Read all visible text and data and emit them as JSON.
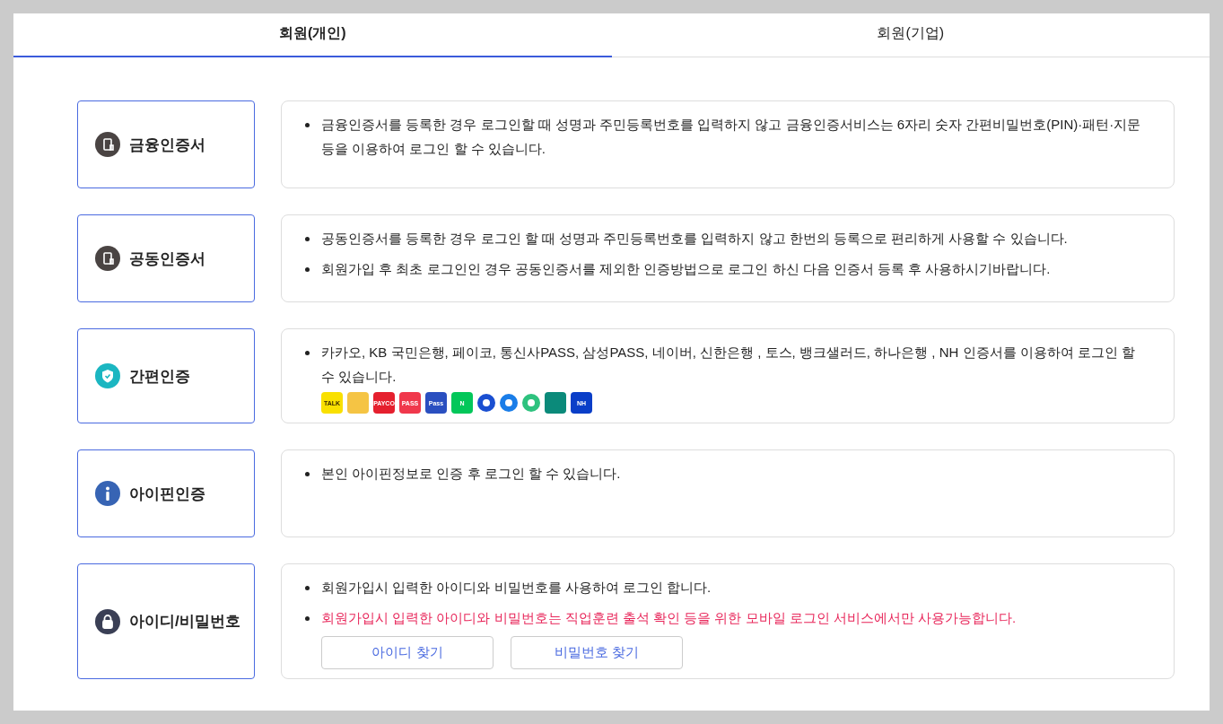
{
  "tabs": [
    {
      "label": "회원(개인)",
      "selected": true
    },
    {
      "label": "회원(기업)",
      "selected": false
    }
  ],
  "methods": [
    {
      "kind": "phone",
      "title": "금융인증서",
      "lines": [
        {
          "kind": "normal",
          "text": "금융인증서를 등록한 경우 로그인할 때 성명과 주민등록번호를 입력하지 않고 금융인증서비스는 6자리 숫자 간편비밀번호(PIN)·패턴·지문등을 이용하여 로그인 할 수 있습니다."
        }
      ]
    },
    {
      "kind": "phone",
      "title": "공동인증서",
      "lines": [
        {
          "kind": "normal",
          "text": "공동인증서를 등록한 경우 로그인 할 때 성명과 주민등록번호를 입력하지 않고 한번의 등록으로 편리하게 사용할 수 있습니다."
        },
        {
          "kind": "normal",
          "text": "회원가입 후 최초 로그인인 경우 공동인증서를 제외한 인증방법으로 로그인 하신 다음 인증서 등록 후 사용하시기바랍니다."
        }
      ]
    },
    {
      "kind": "shield",
      "title": "간편인증",
      "lines": [
        {
          "kind": "normal",
          "text": "카카오, KB 국민은행, 페이코, 통신사PASS, 삼성PASS, 네이버, 신한은행 , 토스, 뱅크샐러드, 하나은행 , NH 인증서를 이용하여 로그인 할 수 있습니다."
        }
      ],
      "logos": [
        {
          "kind": "tile",
          "color": "#f9e000",
          "label": "TALK"
        },
        {
          "kind": "tile",
          "color": "#f5c444"
        },
        {
          "kind": "tile",
          "color": "#e5202e",
          "label": "PAYCO"
        },
        {
          "kind": "tile",
          "color": "#f0384c",
          "label": "PASS"
        },
        {
          "kind": "tile",
          "color": "#2a4fc0",
          "label": "Pass"
        },
        {
          "kind": "tile",
          "color": "#03c75a",
          "label": "N"
        },
        {
          "kind": "mark",
          "color": "#1a4fd1"
        },
        {
          "kind": "mark",
          "color": "#1a7de8"
        },
        {
          "kind": "mark",
          "color": "#2ec27e"
        },
        {
          "kind": "tile",
          "color": "#0b8a7a"
        },
        {
          "kind": "tile",
          "color": "#0a3ec8",
          "label": "NH"
        }
      ]
    },
    {
      "kind": "info",
      "title": "아이핀인증",
      "lines": [
        {
          "kind": "normal",
          "text": "본인 아이핀정보로 인증 후 로그인 할 수 있습니다."
        }
      ]
    },
    {
      "kind": "lock",
      "title": "아이디/비밀번호",
      "lines": [
        {
          "kind": "normal",
          "text": "회원가입시 입력한 아이디와 비밀번호를 사용하여 로그인 합니다."
        },
        {
          "kind": "warning",
          "text": "회원가입시 입력한 아이디와 비밀번호는 직업훈련 출석 확인 등을 위한 모바일 로그인 서비스에서만 사용가능합니다."
        }
      ],
      "buttons": [
        "아이디 찾기",
        "비밀번호 찾기"
      ]
    }
  ]
}
